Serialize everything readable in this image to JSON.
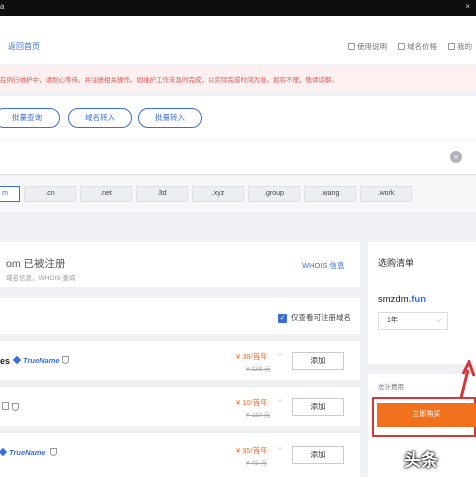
{
  "window": {
    "title_fragment": "а",
    "close_glyph": "×"
  },
  "header": {
    "back_label": "返回首页",
    "links": [
      {
        "label": "使用说明",
        "icon": "doc-icon"
      },
      {
        "label": "域名价格",
        "icon": "price-icon"
      },
      {
        "label": "我的",
        "icon": "user-icon"
      }
    ]
  },
  "notice": {
    "text": "在例行维护中，请耐心等待，并注册相关操作。如维护工作未及时完成，以实际完成时间为准。如有不便，敬请谅解。"
  },
  "actions": {
    "batch_query": "批量查询",
    "domain_transfer": "域名转入",
    "batch_transfer": "批量转入"
  },
  "search": {
    "value": "",
    "clear_glyph": "×"
  },
  "tlds": [
    {
      "label": "m",
      "selected": true
    },
    {
      "label": ".cn",
      "selected": false
    },
    {
      "label": ".net",
      "selected": false
    },
    {
      "label": ".ltd",
      "selected": false
    },
    {
      "label": ".xyz",
      "selected": false
    },
    {
      "label": ".group",
      "selected": false
    },
    {
      "label": ".wang",
      "selected": false
    },
    {
      "label": ".work",
      "selected": false
    }
  ],
  "result": {
    "title": "om 已被注册",
    "subtitle": "域名信息，WHOIS 查询",
    "whois_label": "WHOIS 信息",
    "filter_label": "仅查看可注册域名",
    "filter_checked": true
  },
  "rows": [
    {
      "name": "es",
      "badge": "TrueName",
      "price": "¥ 38/首年",
      "old": "¥ 138 元",
      "add_label": "添加"
    },
    {
      "name": "",
      "badge": "",
      "price": "¥ 10/首年",
      "old": "¥ 110 元",
      "add_label": "添加"
    },
    {
      "name": "",
      "badge": "TrueName",
      "price": "¥ 35/首年",
      "old": "¥ 45 元",
      "add_label": "添加"
    }
  ],
  "cart": {
    "title": "选购清单",
    "domain_name": "smzdm",
    "domain_ext": ".fun",
    "years": "1年",
    "total_label": "总计费用",
    "buy_label": "立即购买"
  },
  "watermark": "头条",
  "colors": {
    "accent": "#3b6fd8",
    "buy": "#f2711c",
    "highlight": "#d23a3a",
    "notice_text": "#e25a5a"
  }
}
